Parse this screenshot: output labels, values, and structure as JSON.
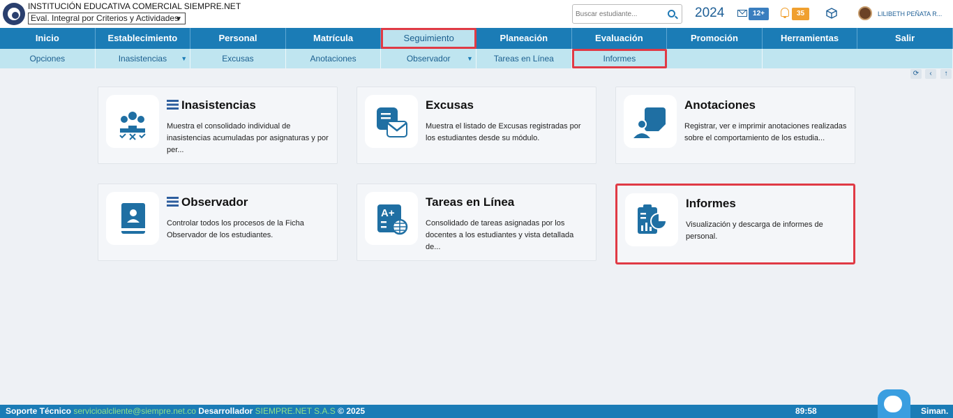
{
  "header": {
    "institution": "INSTITUCIÓN EDUCATIVA COMERCIAL SIEMPRE.NET",
    "eval_select": "Eval. Integral por Criterios y Actividades",
    "search_placeholder": "Buscar estudiante...",
    "year": "2024",
    "mail_badge": "12+",
    "bell_badge": "35",
    "user_name": "LILIBETH PEÑATA R..."
  },
  "mainnav": [
    {
      "label": "Inicio"
    },
    {
      "label": "Establecimiento"
    },
    {
      "label": "Personal"
    },
    {
      "label": "Matrícula"
    },
    {
      "label": "Seguimiento"
    },
    {
      "label": "Planeación"
    },
    {
      "label": "Evaluación"
    },
    {
      "label": "Promoción"
    },
    {
      "label": "Herramientas"
    },
    {
      "label": "Salir"
    }
  ],
  "subnav": [
    {
      "label": "Opciones"
    },
    {
      "label": "Inasistencias"
    },
    {
      "label": "Excusas"
    },
    {
      "label": "Anotaciones"
    },
    {
      "label": "Observador"
    },
    {
      "label": "Tareas en Línea"
    },
    {
      "label": "Informes"
    }
  ],
  "cards": [
    {
      "title": "Inasistencias",
      "desc": "Muestra el consolidado individual de inasistencias acumuladas por asignaturas y por per..."
    },
    {
      "title": "Excusas",
      "desc": "Muestra el listado de Excusas registradas por los estudiantes desde su módulo."
    },
    {
      "title": "Anotaciones",
      "desc": "Registrar, ver e imprimir anotaciones realizadas sobre el comportamiento de los estudia..."
    },
    {
      "title": "Observador",
      "desc": "Controlar todos los procesos de la Ficha Observador de los estudiantes."
    },
    {
      "title": "Tareas en Línea",
      "desc": "Consolidado de tareas asignadas por los docentes a los estudiantes y vista detallada de..."
    },
    {
      "title": "Informes",
      "desc": "Visualización y descarga de informes de personal."
    }
  ],
  "footer": {
    "support_label": "Soporte Técnico",
    "support_email": "servicioalcliente@siempre.net.co",
    "dev_label": "Desarrollador",
    "dev_name": "SIEMPRE.NET S.A.S",
    "copyright": "© 2025",
    "timer": "89:58",
    "brand": "Siman."
  },
  "colors": {
    "primary": "#1b7cb6",
    "subnav": "#bfe5f0",
    "highlight": "#e03a45",
    "icon": "#1f6fa3"
  }
}
